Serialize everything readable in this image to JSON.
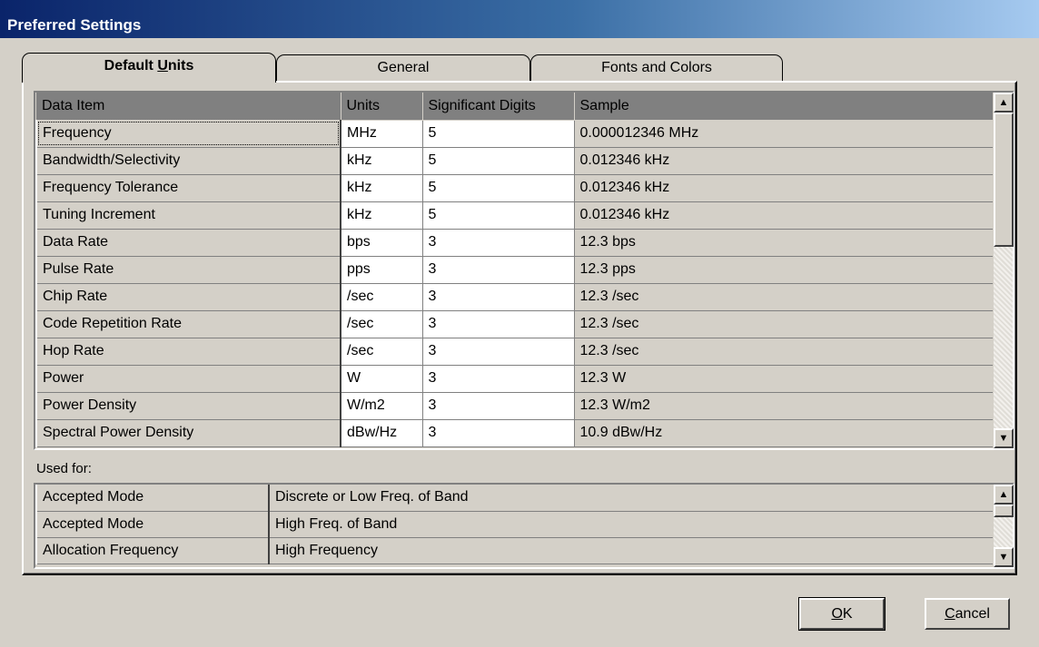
{
  "window": {
    "title": "Preferred Settings"
  },
  "tabs": [
    {
      "label_pre": "Default ",
      "label_u": "U",
      "label_post": "nits",
      "active": true
    },
    {
      "label": "General"
    },
    {
      "label": "Fonts and Colors"
    }
  ],
  "grid": {
    "columns": [
      "Data Item",
      "Units",
      "Significant Digits",
      "Sample"
    ],
    "rows": [
      [
        "Frequency",
        "MHz",
        "5",
        "0.000012346 MHz"
      ],
      [
        "Bandwidth/Selectivity",
        "kHz",
        "5",
        "0.012346 kHz"
      ],
      [
        "Frequency Tolerance",
        "kHz",
        "5",
        "0.012346 kHz"
      ],
      [
        "Tuning Increment",
        "kHz",
        "5",
        "0.012346 kHz"
      ],
      [
        "Data Rate",
        "bps",
        "3",
        "12.3 bps"
      ],
      [
        "Pulse Rate",
        "pps",
        "3",
        "12.3 pps"
      ],
      [
        "Chip Rate",
        "/sec",
        "3",
        "12.3 /sec"
      ],
      [
        "Code Repetition Rate",
        "/sec",
        "3",
        "12.3 /sec"
      ],
      [
        "Hop Rate",
        "/sec",
        "3",
        "12.3 /sec"
      ],
      [
        "Power",
        "W",
        "3",
        "12.3 W"
      ],
      [
        "Power Density",
        "W/m2",
        "3",
        "12.3 W/m2"
      ],
      [
        "Spectral Power Density",
        "dBw/Hz",
        "3",
        "10.9 dBw/Hz"
      ]
    ],
    "scroll_up_icon": "arrow-up-icon",
    "scroll_down_icon": "arrow-down-icon"
  },
  "used_for": {
    "label": "Used for:",
    "rows": [
      [
        "Accepted Mode",
        "Discrete or Low Freq. of Band"
      ],
      [
        "Accepted Mode",
        "High Freq. of Band"
      ],
      [
        "Allocation Frequency",
        "High Frequency"
      ]
    ]
  },
  "buttons": {
    "ok_u": "O",
    "ok_post": "K",
    "cancel_u": "C",
    "cancel_post": "ancel"
  },
  "colors": {
    "title_gradient_start": "#0a246a",
    "title_gradient_end": "#a6caf0",
    "header_bg": "#808080",
    "face": "#d4d0c8"
  }
}
